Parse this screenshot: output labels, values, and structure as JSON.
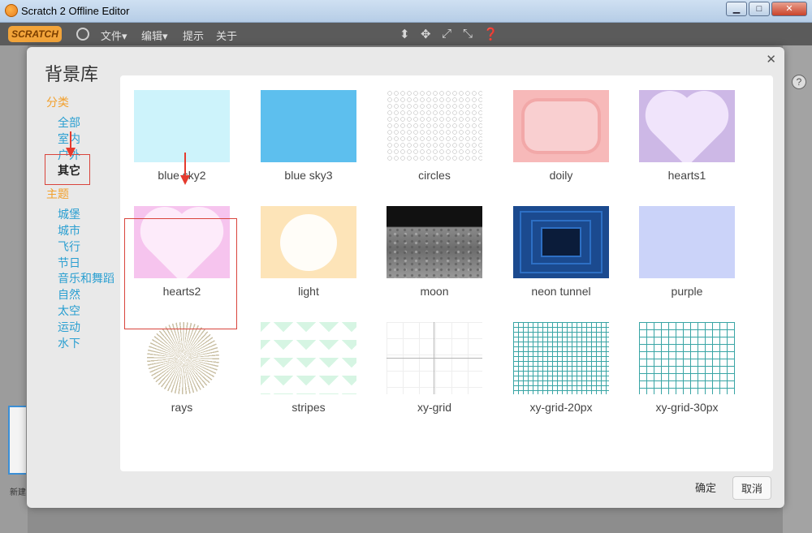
{
  "window": {
    "title": "Scratch 2 Offline Editor",
    "minimize": "▁",
    "maximize": "□",
    "close": "✕"
  },
  "menubar": {
    "logo": "SCRATCH",
    "items": [
      "文件▾",
      "编辑▾",
      "提示",
      "关于"
    ]
  },
  "modal": {
    "title": "背景库",
    "close": "✕",
    "category_heading": "分类",
    "categories": [
      "全部",
      "室内",
      "户外",
      "其它"
    ],
    "selected_category": "其它",
    "theme_heading": "主题",
    "themes": [
      "城堡",
      "城市",
      "飞行",
      "节日",
      "音乐和舞蹈",
      "自然",
      "太空",
      "运动",
      "水下"
    ],
    "backdrops": [
      "blue sky2",
      "blue sky3",
      "circles",
      "doily",
      "hearts1",
      "hearts2",
      "light",
      "moon",
      "neon tunnel",
      "purple",
      "rays",
      "stripes",
      "xy-grid",
      "xy-grid-20px",
      "xy-grid-30px"
    ],
    "selected_backdrop": "hearts2",
    "ok_label": "确定",
    "cancel_label": "取消"
  },
  "editor": {
    "new_backdrop_label": "新建"
  },
  "colors": {
    "accent_orange": "#f2a02c",
    "link_blue": "#2a9fd1",
    "highlight_red": "#d9443c"
  }
}
